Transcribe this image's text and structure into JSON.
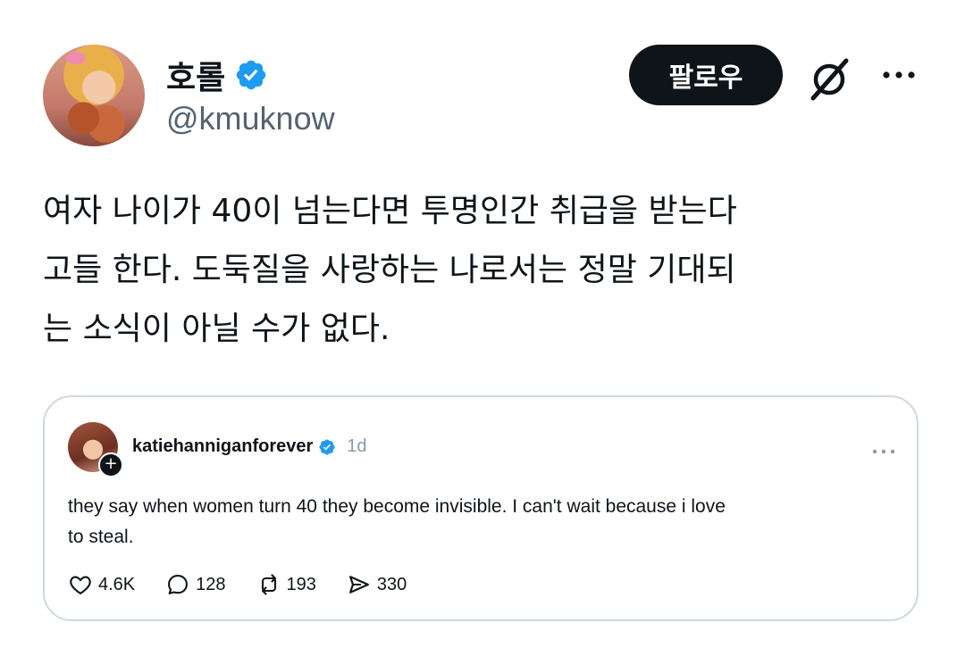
{
  "post": {
    "display_name": "호롤",
    "handle": "@kmuknow",
    "follow_label": "팔로우",
    "text": "여자 나이가 40이 넘는다면 투명인간 취급을 받는다\n고들 한다. 도둑질을 사랑하는 나로서는 정말 기대되\n는 소식이 아닐 수가 없다."
  },
  "quote": {
    "username": "katiehanniganforever",
    "time": "1d",
    "text": "they say when women turn 40 they become invisible. I can't wait because i love\nto steal.",
    "likes": "4.6K",
    "replies": "128",
    "reposts": "193",
    "shares": "330"
  },
  "colors": {
    "verified": "#1d9bf0",
    "text": "#0f1419",
    "secondary": "#536471",
    "border": "#cfd9de"
  },
  "icons": [
    "verified-icon",
    "grok-icon",
    "more-icon",
    "heart-icon",
    "comment-icon",
    "repost-icon",
    "share-icon",
    "add-icon"
  ]
}
